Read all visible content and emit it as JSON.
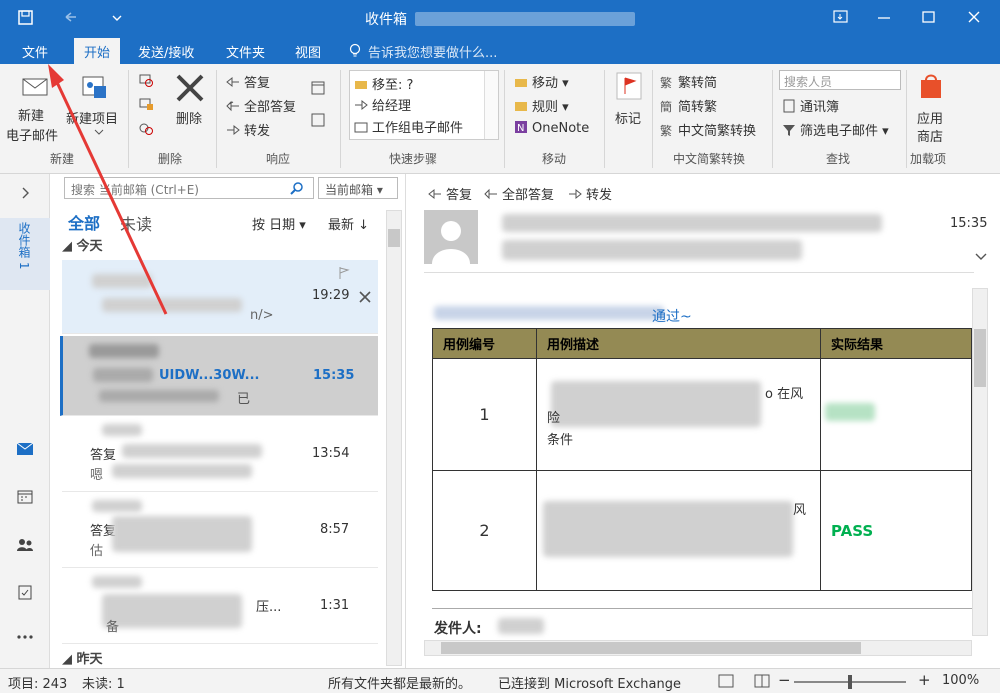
{
  "title": "收件箱",
  "tabs": [
    "文件",
    "开始",
    "发送/接收",
    "文件夹",
    "视图"
  ],
  "tellme": "告诉我您想要做什么...",
  "ribbon": {
    "new_mail": "新建\n电子邮件",
    "new_mail_l1": "新建",
    "new_mail_l2": "电子邮件",
    "new_item": "新建项目",
    "delete": "删除",
    "reply": "答复",
    "reply_all": "全部答复",
    "forward": "转发",
    "quick_steps": [
      "移至: ?",
      "给经理",
      "工作组电子邮件"
    ],
    "move": "移动",
    "rules": "规则",
    "onenote": "OneNote",
    "flag_l1": "标记",
    "trad": "繁转简",
    "simp": "简转繁",
    "conv": "中文简繁转换",
    "search_people": "搜索人员",
    "address_book": "通讯簿",
    "filter_mail": "筛选电子邮件",
    "apps_l1": "应用",
    "apps_l2": "商店",
    "groups": [
      "新建",
      "删除",
      "响应",
      "快速步骤",
      "移动",
      "中文简繁转换",
      "查找",
      "加载项"
    ]
  },
  "leftnav": {
    "folder_label": "收件箱 1"
  },
  "search": {
    "placeholder": "搜索 当前邮箱 (Ctrl+E)",
    "scope": "当前邮箱"
  },
  "filter": {
    "all": "全部",
    "unread": "未读",
    "sort": "按 日期",
    "order": "最新"
  },
  "sections": {
    "today": "今天",
    "yesterday": "昨天"
  },
  "mails": [
    {
      "line2": "n/>",
      "time": "19:29"
    },
    {
      "line1": "UIDW...30W...",
      "line2": "已",
      "time": "15:35"
    },
    {
      "line1": "答复",
      "line2": "嗯",
      "time": "13:54"
    },
    {
      "line1": "答复",
      "line2": "估",
      "time": "8:57"
    },
    {
      "line1": "压...",
      "line2": "备",
      "time": "1:31"
    }
  ],
  "reading": {
    "reply": "答复",
    "reply_all": "全部答复",
    "forward": "转发",
    "time": "15:35",
    "intro": "通过~",
    "table_headers": [
      "用例编号",
      "用例描述",
      "实际结果"
    ],
    "rows": [
      {
        "id": "1",
        "desc1": "o 在风",
        "desc2": "险",
        "desc3": "条件",
        "result": ""
      },
      {
        "id": "2",
        "desc1": "风",
        "desc2": "",
        "desc3": "",
        "result": "PASS"
      }
    ],
    "sender_label": "发件人:"
  },
  "status": {
    "items": "项目: 243",
    "unread": "未读: 1",
    "msg1": "所有文件夹都是最新的。",
    "msg2": "已连接到 Microsoft Exchange",
    "zoom": "100%"
  },
  "colors": {
    "brand": "#1d6fc5",
    "table_header": "#948a54",
    "pass": "#00b050",
    "arrow": "#e53935"
  }
}
